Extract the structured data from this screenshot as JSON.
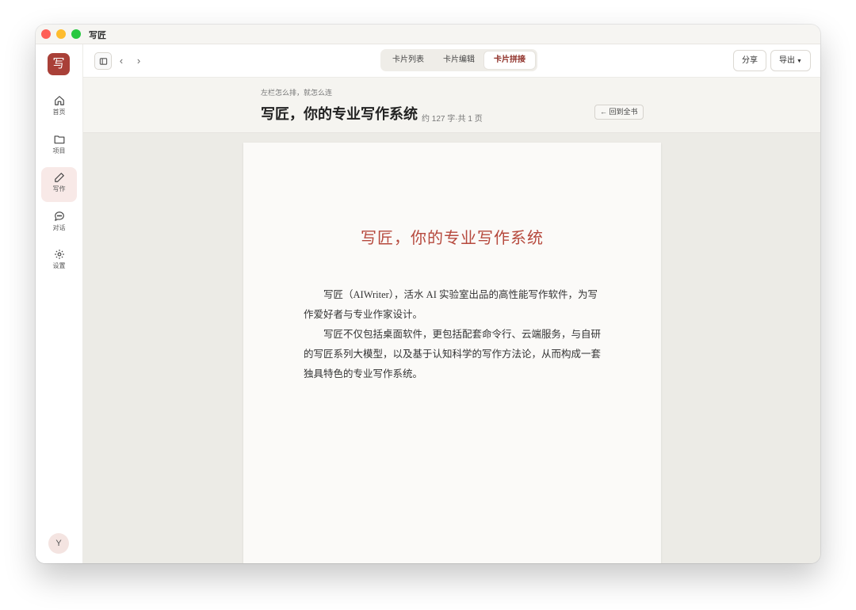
{
  "window": {
    "title": "写匠"
  },
  "sidebar": {
    "logo": "写",
    "items": [
      {
        "label": "首页",
        "icon": "home-icon"
      },
      {
        "label": "项目",
        "icon": "folder-icon"
      },
      {
        "label": "写作",
        "icon": "pencil-icon",
        "active": true
      },
      {
        "label": "对话",
        "icon": "chat-icon"
      },
      {
        "label": "设置",
        "icon": "gear-icon"
      }
    ],
    "avatar": "Y"
  },
  "toolbar": {
    "back": "‹",
    "forward": "›",
    "tabs": [
      {
        "label": "卡片列表"
      },
      {
        "label": "卡片编辑"
      },
      {
        "label": "卡片拼接",
        "active": true
      }
    ],
    "share_label": "分享",
    "export_label": "导出"
  },
  "header": {
    "subtitle": "左栏怎么排，就怎么连",
    "title": "写匠，你的专业写作系统",
    "meta": "约 127 字·共 1 页",
    "back_label": "← 回到全书"
  },
  "document": {
    "title": "写匠，你的专业写作系统",
    "paragraphs": [
      "写匠（AIWriter），活水 AI 实验室出品的高性能写作软件，为写作爱好者与专业作家设计。",
      "写匠不仅包括桌面软件，更包括配套命令行、云端服务，与自研的写匠系列大模型，以及基于认知科学的写作方法论，从而构成一套独具特色的专业写作系统。"
    ]
  },
  "colors": {
    "brand": "#a94038",
    "title_accent": "#b6493d"
  }
}
